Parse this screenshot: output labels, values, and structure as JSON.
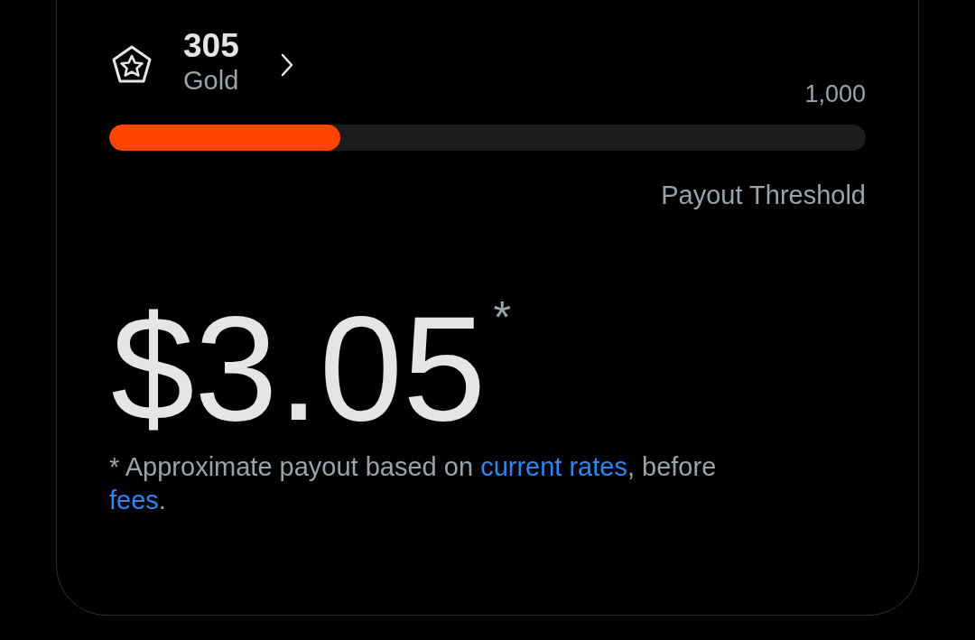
{
  "tier": {
    "points": "305",
    "name": "Gold"
  },
  "progress": {
    "max_label": "1,000",
    "level": 0.305,
    "label": "Payout Threshold"
  },
  "payout": {
    "amount": "$3.05",
    "mark": "*"
  },
  "footnote": [
    {
      "kind": "text",
      "text": "* Approximate payout based on "
    },
    {
      "kind": "link",
      "text": "current rates"
    },
    {
      "kind": "text",
      "text": ", before "
    },
    {
      "kind": "link",
      "text": "fees"
    },
    {
      "kind": "text",
      "text": "."
    }
  ]
}
